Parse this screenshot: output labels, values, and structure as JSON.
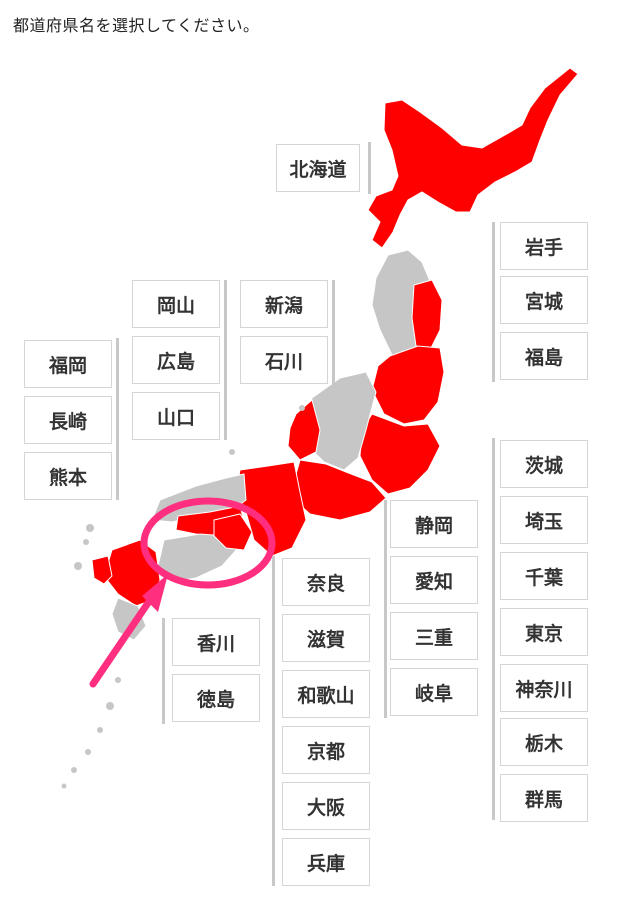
{
  "instruction": "都道府県名を選択してください。",
  "colors": {
    "selected": "#ff0000",
    "unselected": "#c6c6c6",
    "highlight": "#ff2e7e"
  },
  "prefectures": {
    "hokkaido": "北海道",
    "iwate": "岩手",
    "miyagi": "宮城",
    "fukushima": "福島",
    "okayama": "岡山",
    "niigata": "新潟",
    "hiroshima": "広島",
    "ishikawa": "石川",
    "yamaguchi": "山口",
    "fukuoka": "福岡",
    "nagasaki": "長崎",
    "kumamoto": "熊本",
    "ibaraki": "茨城",
    "saitama": "埼玉",
    "chiba": "千葉",
    "tokyo": "東京",
    "kanagawa": "神奈川",
    "tochigi": "栃木",
    "gunma": "群馬",
    "shizuoka": "静岡",
    "aichi": "愛知",
    "mie": "三重",
    "gifu": "岐阜",
    "nara": "奈良",
    "shiga": "滋賀",
    "wakayama": "和歌山",
    "kyoto": "京都",
    "osaka": "大阪",
    "hyogo": "兵庫",
    "kagawa": "香川",
    "tokushima": "徳島"
  }
}
